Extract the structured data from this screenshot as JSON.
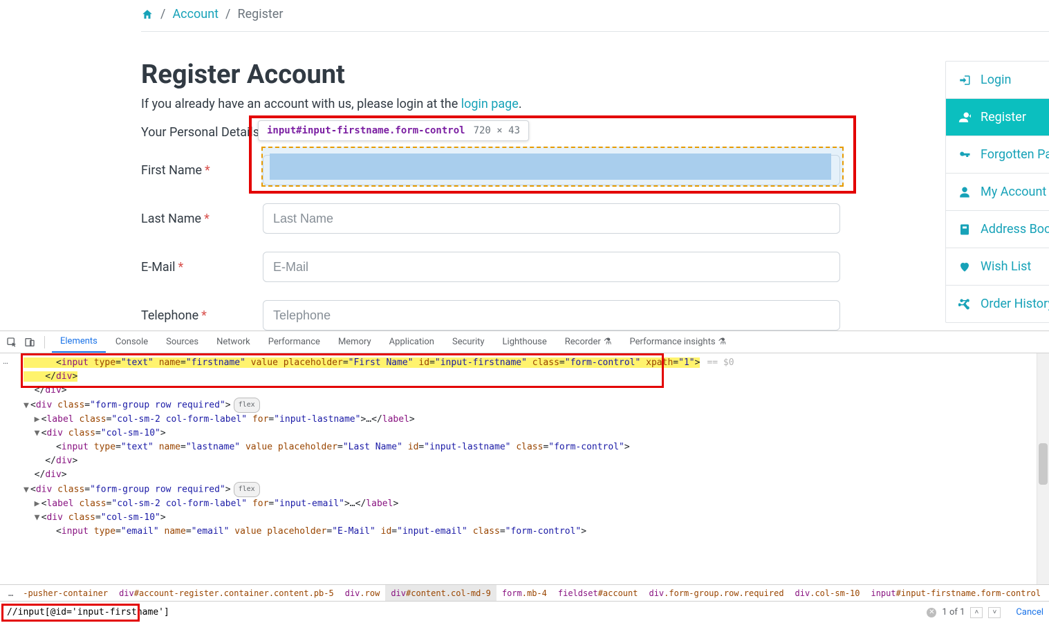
{
  "breadcrumb": {
    "account": "Account",
    "register": "Register"
  },
  "page": {
    "title": "Register Account",
    "intro_prefix": "If you already have an account with us, please login at the ",
    "login_link": "login page",
    "intro_suffix": ".",
    "legend": "Your Personal Details"
  },
  "form": {
    "labels": {
      "firstname": "First Name",
      "lastname": "Last Name",
      "email": "E-Mail",
      "telephone": "Telephone"
    },
    "placeholders": {
      "firstname": "First Name",
      "lastname": "Last Name",
      "email": "E-Mail",
      "telephone": "Telephone"
    }
  },
  "inspect_tooltip": {
    "selector": "input#input-firstname.form-control",
    "dims": "720 × 43"
  },
  "sidebar": {
    "items": [
      {
        "label": "Login"
      },
      {
        "label": "Register"
      },
      {
        "label": "Forgotten Pas"
      },
      {
        "label": "My Account"
      },
      {
        "label": "Address Book"
      },
      {
        "label": "Wish List"
      },
      {
        "label": "Order History"
      }
    ]
  },
  "devtools": {
    "tabs": [
      "Elements",
      "Console",
      "Sources",
      "Network",
      "Performance",
      "Memory",
      "Application",
      "Security",
      "Lighthouse",
      "Recorder",
      "Performance insights"
    ],
    "active_tab": "Elements",
    "highlighted_line": "<input type=\"text\" name=\"firstname\" value placeholder=\"First Name\" id=\"input-firstname\" class=\"form-control\" xpath=\"1\">",
    "after_selection": "== $0",
    "flex_badge": "flex",
    "crumbs": [
      "-pusher-container",
      "div#account-register.container.content.pb-5",
      "div.row",
      "div#content.col-md-9",
      "form.mb-4",
      "fieldset#account",
      "div.form-group.row.required",
      "div.col-sm-10",
      "input#input-firstname.form-control"
    ],
    "crumbs_selected_index": 3,
    "search": {
      "query": "//input[@id='input-firstname']",
      "result": "1 of 1",
      "cancel": "Cancel"
    }
  }
}
